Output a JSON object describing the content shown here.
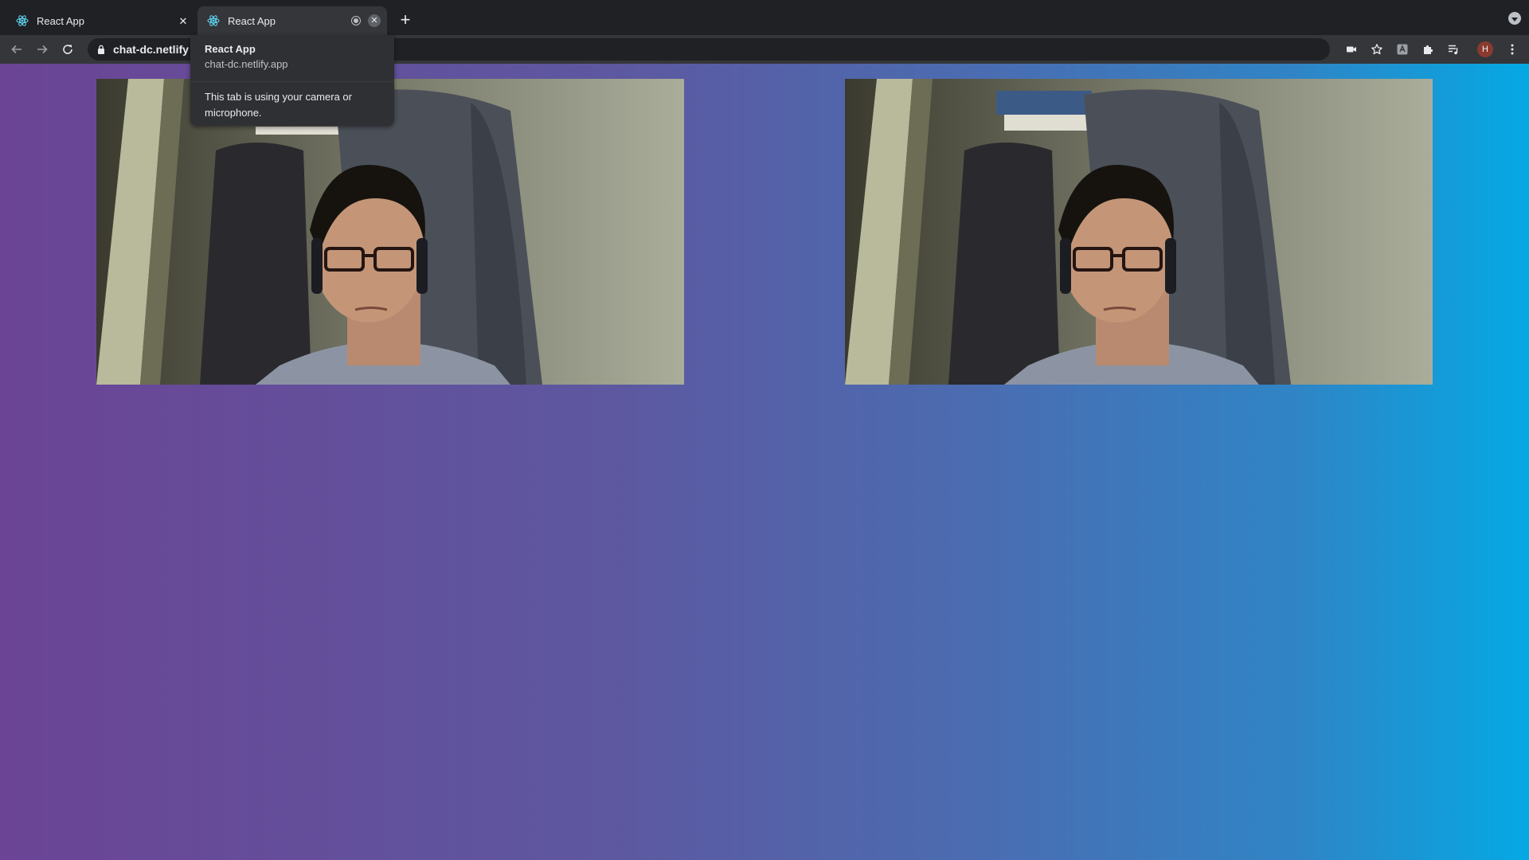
{
  "browser": {
    "tabs": [
      {
        "title": "React App",
        "active": false
      },
      {
        "title": "React App",
        "active": true,
        "recording": true
      }
    ],
    "new_tab_label": "+",
    "address": "chat-dc.netlify"
  },
  "hovercard": {
    "title": "React App",
    "domain": "chat-dc.netlify.app",
    "alert": "This tab is using your camera or microphone."
  },
  "profile": {
    "initial": "H"
  },
  "colors": {
    "gradient_start": "#6b4495",
    "gradient_end": "#04a9e4",
    "react_logo": "#61dafb"
  }
}
